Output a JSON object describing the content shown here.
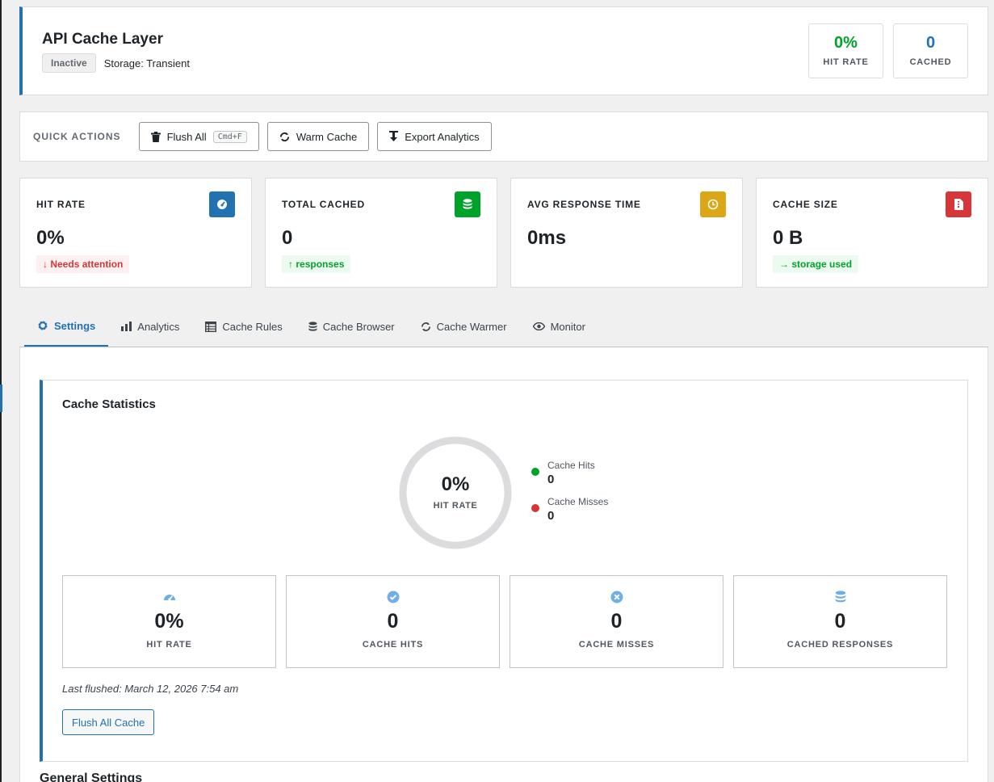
{
  "header": {
    "title": "API Cache Layer",
    "status": "Inactive",
    "storage": "Storage: Transient",
    "stats": [
      {
        "value": "0%",
        "label": "HIT RATE",
        "color": "#00a32a"
      },
      {
        "value": "0",
        "label": "CACHED",
        "color": "#2271b1"
      }
    ]
  },
  "quick_actions": {
    "label": "QUICK ACTIONS",
    "flush": "Flush All",
    "flush_shortcut": "Cmd+F",
    "warm": "Warm Cache",
    "export": "Export Analytics"
  },
  "cards": [
    {
      "label": "HIT RATE",
      "value": "0%",
      "trend": "Needs attention",
      "trend_dir": "down",
      "icon": "gauge-icon",
      "color": "#2271b1"
    },
    {
      "label": "TOTAL CACHED",
      "value": "0",
      "trend": "responses",
      "trend_dir": "up",
      "icon": "database-icon",
      "color": "#00a32a"
    },
    {
      "label": "AVG RESPONSE TIME",
      "value": "0ms",
      "icon": "clock-icon",
      "color": "#dba617"
    },
    {
      "label": "CACHE SIZE",
      "value": "0 B",
      "trend": "storage used",
      "trend_dir": "right",
      "icon": "file-icon",
      "color": "#d63638"
    }
  ],
  "tabs": [
    {
      "label": "Settings",
      "icon": "gear-icon"
    },
    {
      "label": "Analytics",
      "icon": "bar-chart-icon"
    },
    {
      "label": "Cache Rules",
      "icon": "table-icon"
    },
    {
      "label": "Cache Browser",
      "icon": "database-icon"
    },
    {
      "label": "Cache Warmer",
      "icon": "refresh-icon"
    },
    {
      "label": "Monitor",
      "icon": "eye-icon"
    }
  ],
  "statistics": {
    "title": "Cache Statistics",
    "donut_value": "0%",
    "donut_label": "HIT RATE",
    "hit_fraction": 0,
    "legend": [
      {
        "name": "Cache Hits",
        "value": "0",
        "color": "#00a32a"
      },
      {
        "name": "Cache Misses",
        "value": "0",
        "color": "#d63638"
      }
    ],
    "mini": [
      {
        "value": "0%",
        "label": "HIT RATE",
        "icon": "gauge-icon"
      },
      {
        "value": "0",
        "label": "CACHE HITS",
        "icon": "check-circle-icon"
      },
      {
        "value": "0",
        "label": "CACHE MISSES",
        "icon": "x-circle-icon"
      },
      {
        "value": "0",
        "label": "CACHED RESPONSES",
        "icon": "database-icon"
      }
    ],
    "last_flushed": "Last flushed: March 12, 2026 7:54 am",
    "flush_button": "Flush All Cache"
  },
  "general_settings": "General Settings"
}
